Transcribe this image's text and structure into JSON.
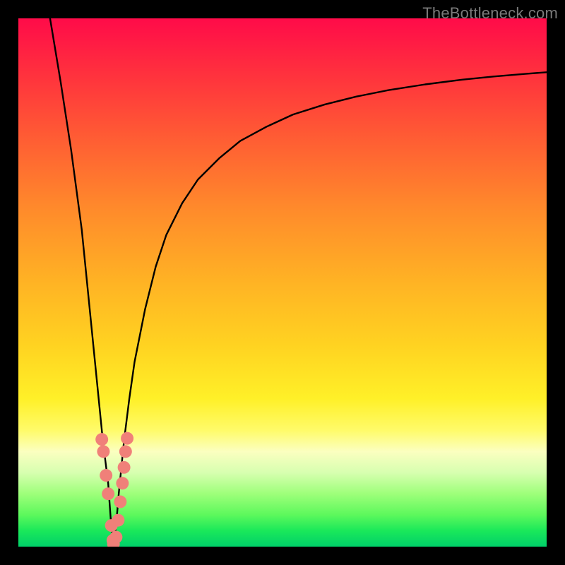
{
  "watermark": "TheBottleneck.com",
  "chart_data": {
    "type": "line",
    "title": "",
    "xlabel": "",
    "ylabel": "",
    "xlim": [
      0,
      100
    ],
    "ylim": [
      0,
      100
    ],
    "grid": false,
    "legend": false,
    "notes": "Axes have no visible tick labels or titles; values are in percent of plot width/height. y=0 at bottom (green), y=100 at top (red). The black curve is a V-shaped dip reaching y≈0 near x≈18, with the right branch rising asymptotically toward the upper right.",
    "series": [
      {
        "name": "bottleneck-curve",
        "color": "#000000",
        "x": [
          6,
          8,
          10,
          12,
          13,
          14,
          15,
          16,
          17,
          17.5,
          18,
          18.5,
          19,
          20,
          21,
          22,
          24,
          26,
          28,
          31,
          34,
          38,
          42,
          47,
          52,
          58,
          64,
          70,
          77,
          84,
          90,
          96,
          100
        ],
        "y": [
          100,
          88,
          75,
          60,
          50,
          40,
          30,
          20,
          12,
          5,
          0,
          4,
          10,
          20,
          28,
          35,
          45,
          53,
          59,
          65,
          69.5,
          73.5,
          76.8,
          79.5,
          81.8,
          83.7,
          85.2,
          86.4,
          87.5,
          88.4,
          89.0,
          89.5,
          89.8
        ]
      }
    ],
    "markers": {
      "name": "highlight-dots",
      "color": "#f08079",
      "radius_pct": 1.2,
      "points": [
        {
          "x": 15.8,
          "y": 20.3
        },
        {
          "x": 16.1,
          "y": 18.0
        },
        {
          "x": 16.6,
          "y": 13.5
        },
        {
          "x": 17.0,
          "y": 10.0
        },
        {
          "x": 17.6,
          "y": 4.0
        },
        {
          "x": 17.9,
          "y": 1.2
        },
        {
          "x": 18.0,
          "y": 0.5
        },
        {
          "x": 18.5,
          "y": 1.8
        },
        {
          "x": 18.9,
          "y": 5.0
        },
        {
          "x": 19.3,
          "y": 8.5
        },
        {
          "x": 19.7,
          "y": 12.0
        },
        {
          "x": 20.0,
          "y": 15.0
        },
        {
          "x": 20.3,
          "y": 18.0
        },
        {
          "x": 20.6,
          "y": 20.5
        }
      ]
    }
  }
}
